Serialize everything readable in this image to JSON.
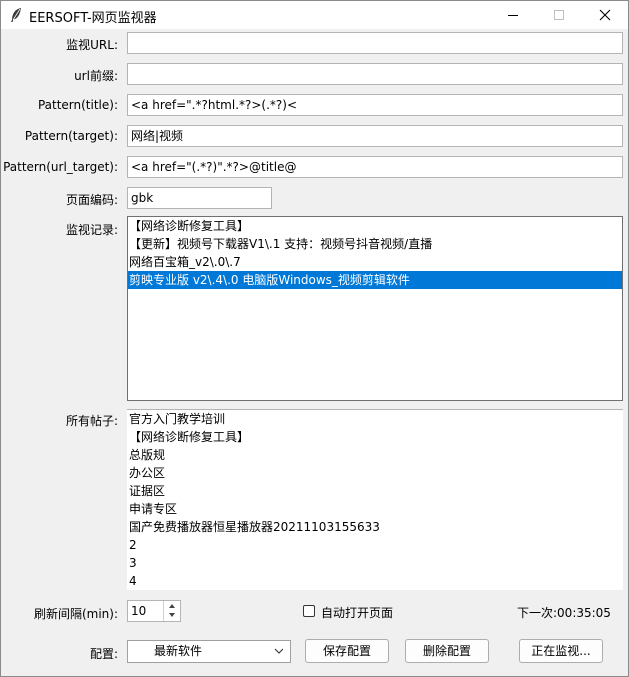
{
  "window": {
    "title": "EERSOFT-网页监视器"
  },
  "form": {
    "monitor_url": {
      "label": "监视URL:",
      "value": ""
    },
    "url_prefix": {
      "label": "url前缀:",
      "value": ""
    },
    "pattern_title": {
      "label": "Pattern(title):",
      "value": "<a href=\".*?html.*?>(.*?)<"
    },
    "pattern_target": {
      "label": "Pattern(target):",
      "value": "网络|视频"
    },
    "pattern_url_target": {
      "label": "Pattern(url_target):",
      "value": "<a href=\"(.*?)\".*?>@title@"
    },
    "page_encoding": {
      "label": "页面编码:",
      "value": "gbk"
    }
  },
  "monitor_records": {
    "label": "监视记录:",
    "items": [
      "【网络诊断修复工具】",
      "【更新】视频号下载器V1\\.1 支持：视频号抖音视频/直播",
      "网络百宝箱_v2\\.0\\.7",
      "剪映专业版 v2\\.4\\.0 电脑版Windows_视频剪辑软件"
    ],
    "selected_index": 3
  },
  "all_posts": {
    "label": "所有帖子:",
    "lines": [
      "官方入门教学培训",
      "【网络诊断修复工具】",
      "总版规",
      "办公区",
      "证据区",
      "申请专区",
      "国产免费播放器恒星播放器20211103155633",
      "2",
      "3",
      "4"
    ]
  },
  "controls": {
    "refresh_label": "刷新间隔(min):",
    "refresh_value": "10",
    "auto_open_label": "自动打开页面",
    "auto_open_checked": false,
    "next_run": "下一次:00:35:05"
  },
  "config": {
    "label": "配置:",
    "selected": "最新软件",
    "save_label": "保存配置",
    "delete_label": "删除配置",
    "monitor_label": "正在监视..."
  },
  "colors": {
    "selection": "#0078d7",
    "window_bg": "#f0f0f0"
  }
}
